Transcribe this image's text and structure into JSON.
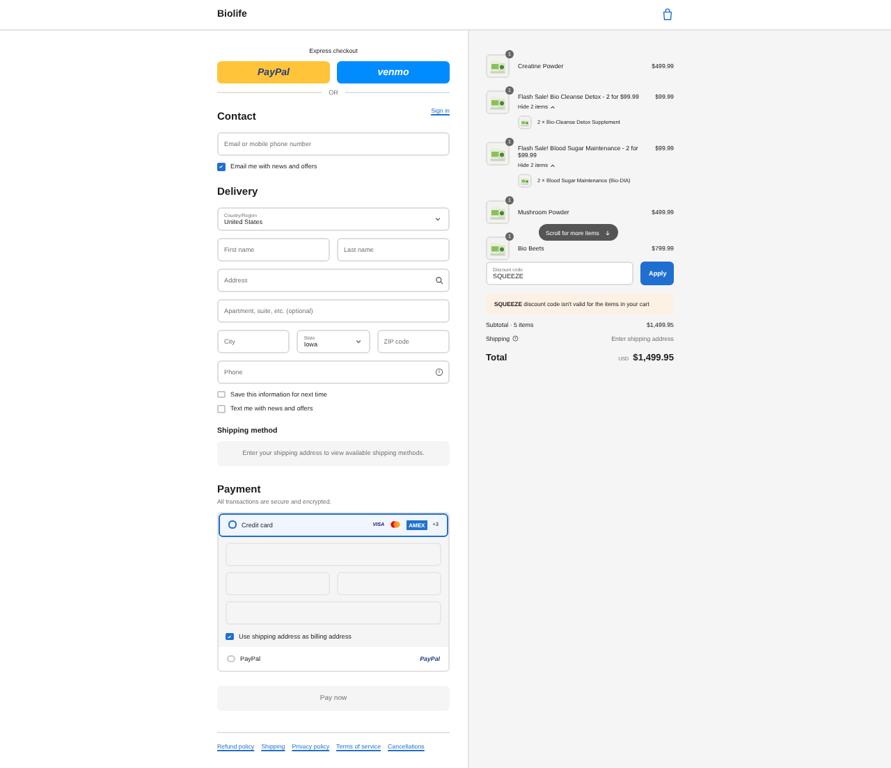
{
  "header": {
    "store_name": "Biolife"
  },
  "express": {
    "title": "Express checkout",
    "buttons": [
      {
        "kind": "paypal",
        "label": "PayPal"
      },
      {
        "kind": "venmo",
        "label": "venmo"
      }
    ],
    "divider": "OR"
  },
  "contact": {
    "title": "Contact",
    "link": "Sign in",
    "email_placeholder": "Email or mobile phone number",
    "newsletter": {
      "label": "Email me with news and offers",
      "checked": true
    }
  },
  "delivery": {
    "title": "Delivery",
    "country": {
      "label": "Country/Region",
      "value": "United States"
    },
    "first_name": {
      "placeholder": "First name"
    },
    "last_name": {
      "placeholder": "Last name"
    },
    "address": {
      "placeholder": "Address"
    },
    "apartment": {
      "placeholder": "Apartment, suite, etc. (optional)"
    },
    "city": {
      "placeholder": "City"
    },
    "state": {
      "label": "State",
      "value": "Iowa"
    },
    "zip": {
      "placeholder": "ZIP code"
    },
    "phone": {
      "placeholder": "Phone"
    },
    "options": [
      {
        "label": "Save this information for next time",
        "checked": false
      },
      {
        "label": "Text me with news and offers",
        "checked": false
      }
    ]
  },
  "shipping_method": {
    "title": "Shipping method",
    "message": "Enter your shipping address to view available shipping methods."
  },
  "payment": {
    "title": "Payment",
    "subtitle": "All transactions are secure and encrypted.",
    "methods": [
      {
        "kind": "card",
        "label": "Credit card",
        "selected": true,
        "brands": [
          "VISA",
          "AMEX",
          "+3"
        ],
        "billing": {
          "label": "Use shipping address as billing address",
          "checked": true
        }
      },
      {
        "kind": "paypal",
        "label": "PayPal",
        "selected": false,
        "logo": "PayPal"
      }
    ],
    "pay_button": "Pay now"
  },
  "footer_links": [
    "Refund policy",
    "Shipping",
    "Privacy policy",
    "Terms of service",
    "Cancellations"
  ],
  "cart": {
    "items": [
      {
        "name": "Creatine Powder",
        "price": "$499.99",
        "quantity": "1"
      },
      {
        "name": "Flash Sale! Bio Cleanse Detox - 2 for $99.99",
        "price": "$99.99",
        "quantity": "1",
        "toggle": "Hide 2 items",
        "children": [
          {
            "name": "2 × Bio-Cleanse Detox Supplement"
          }
        ]
      },
      {
        "name": "Flash Sale! Blood Sugar Maintenance - 2 for $99.99",
        "price": "$99.99",
        "quantity": "1",
        "toggle": "Hide 2 items",
        "children": [
          {
            "name": "2 × Blood Sugar Maintenance (Bio-DIA)"
          }
        ]
      },
      {
        "name": "Mushroom Powder",
        "price": "$499.99",
        "quantity": "1"
      },
      {
        "name": "Bio Beets",
        "price": "$799.99",
        "quantity": "1"
      }
    ],
    "scroll_hint": "Scroll for more items",
    "discount": {
      "label": "Discount code",
      "value": "SQUEEZE",
      "button": "Apply"
    },
    "error": "**SQUEEZE** discount code isn't valid for the items in your cart",
    "subtotal": {
      "label": "Subtotal · 5 items",
      "value": "$1,499.95"
    },
    "shipping": {
      "label": "Shipping",
      "value": "Enter shipping address"
    },
    "total": {
      "label": "Total",
      "currency": "USD",
      "value": "$1,499.95"
    }
  }
}
